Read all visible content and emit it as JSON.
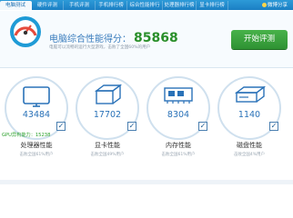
{
  "tabs": [
    {
      "label": "电脑测试"
    },
    {
      "label": "硬件评测"
    },
    {
      "label": "手机评测"
    },
    {
      "label": "手机排行榜"
    },
    {
      "label": "综合性能排行榜"
    },
    {
      "label": "处理器排行榜"
    },
    {
      "label": "显卡排行榜"
    }
  ],
  "share_label": "微博分享",
  "score": {
    "title": "电脑综合性能得分：",
    "value": "85868",
    "description": "电脑可以流畅的运行大型游戏，击败了全国60%的用户",
    "start_button": "开始评测"
  },
  "cards": [
    {
      "value": "43484",
      "label": "处理器性能",
      "sub": "击败全国61%用户",
      "icon": "monitor-icon"
    },
    {
      "value": "17702",
      "label": "显卡性能",
      "sub": "击败全国49%用户",
      "icon": "graphics-card-icon"
    },
    {
      "value": "8304",
      "label": "内存性能",
      "sub": "击败全国61%用户",
      "icon": "memory-icon"
    },
    {
      "value": "1140",
      "label": "磁盘性能",
      "sub": "击败全国4%用户",
      "icon": "disk-icon"
    }
  ],
  "gpu_note": "GPU异构能力：15238",
  "colors": {
    "accent": "#1b7fc3",
    "score": "#2a8f2a",
    "button": "#3aa03d"
  }
}
